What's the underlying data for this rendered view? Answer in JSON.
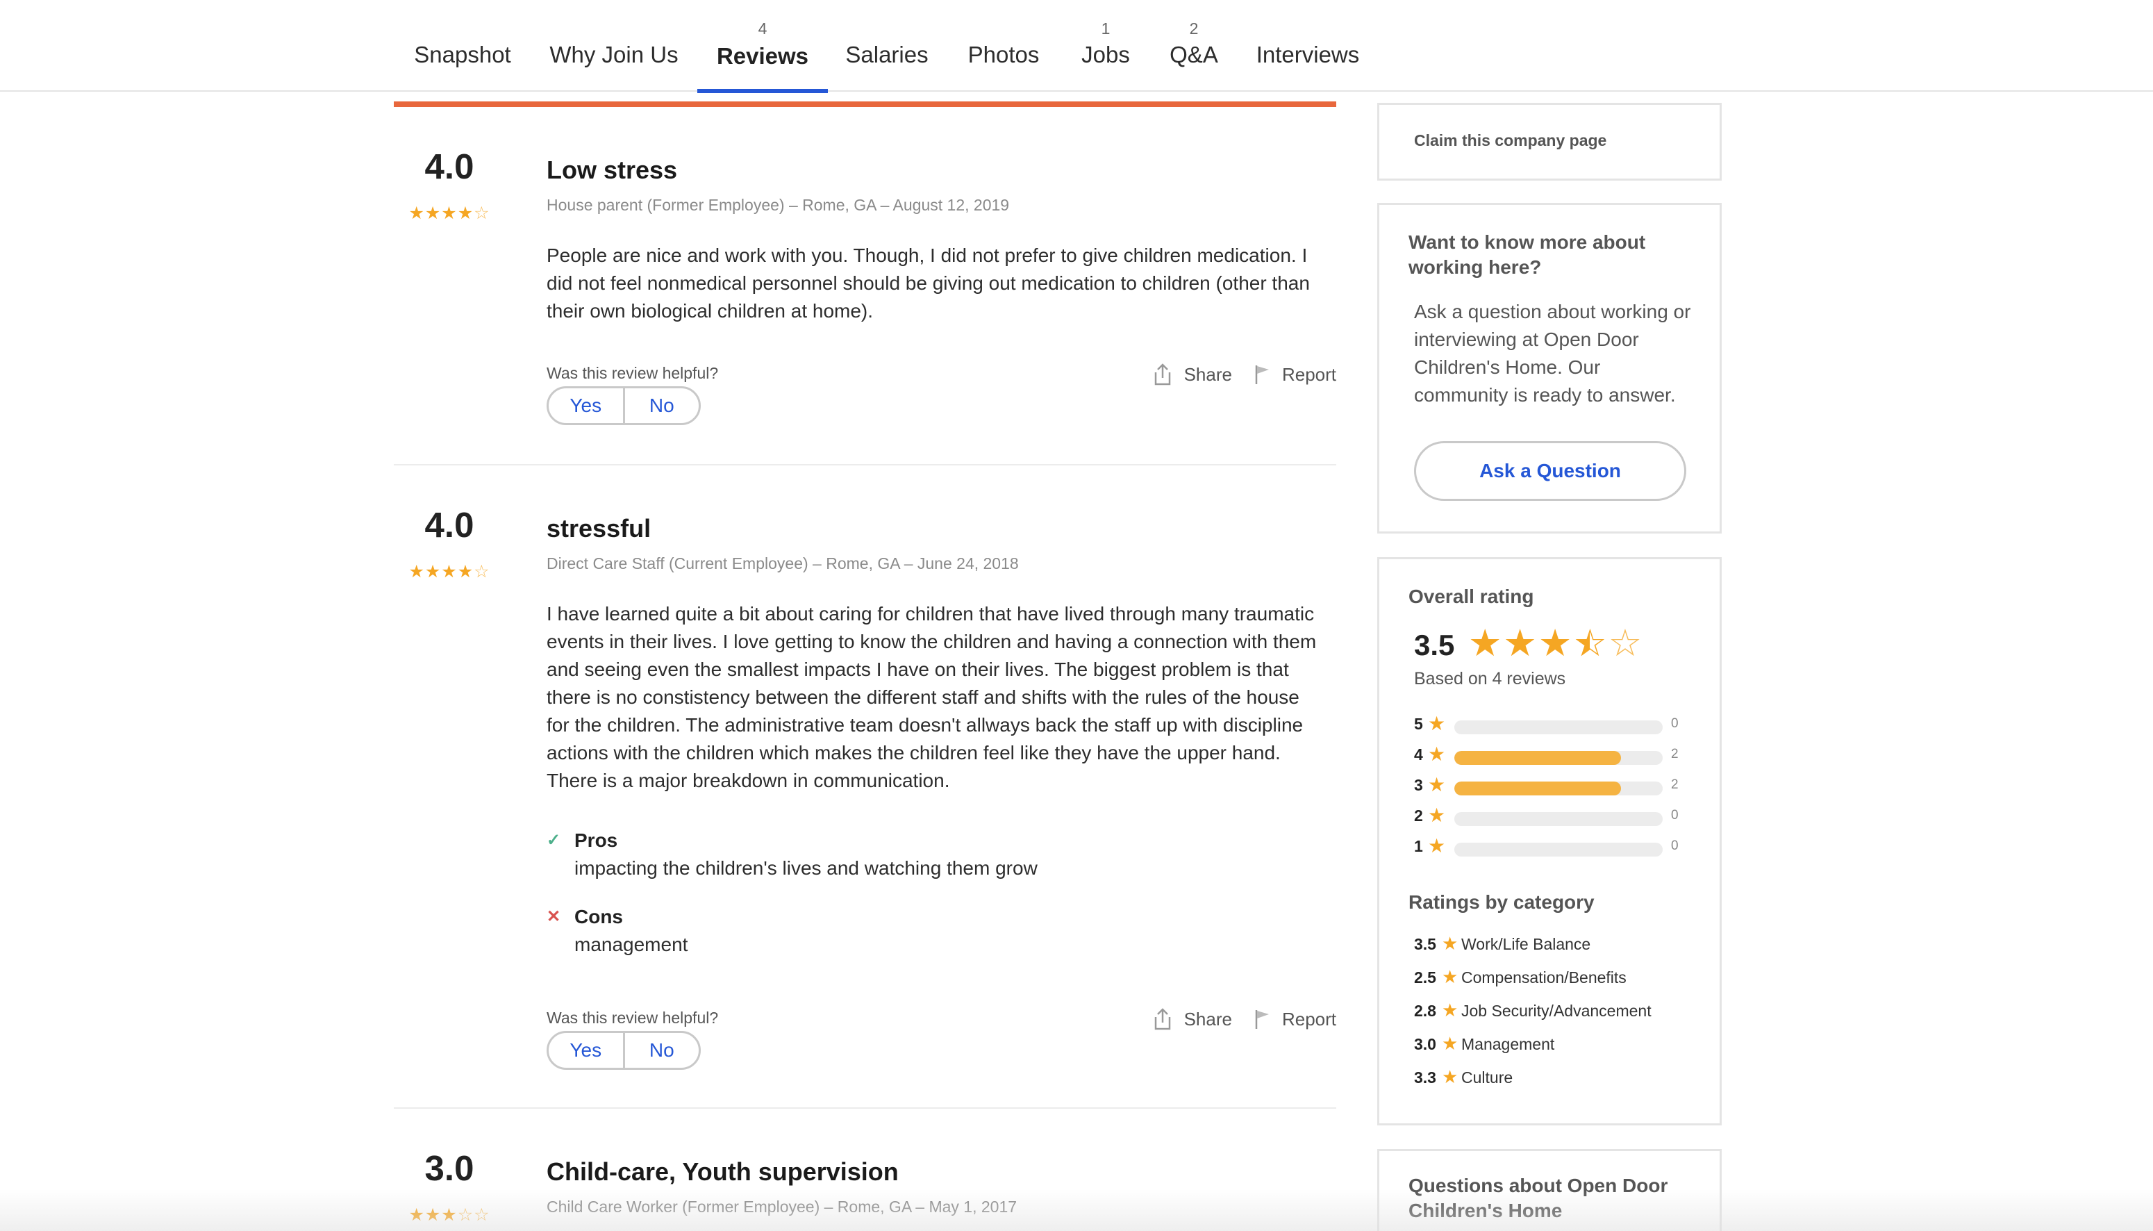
{
  "nav": {
    "tabs": [
      {
        "label": "Snapshot",
        "count": ""
      },
      {
        "label": "Why Join Us",
        "count": ""
      },
      {
        "label": "Reviews",
        "count": "4"
      },
      {
        "label": "Salaries",
        "count": ""
      },
      {
        "label": "Photos",
        "count": ""
      },
      {
        "label": "Jobs",
        "count": "1"
      },
      {
        "label": "Q&A",
        "count": "2"
      },
      {
        "label": "Interviews",
        "count": ""
      }
    ],
    "active_tab": "Reviews",
    "accent_color": "#2557d6"
  },
  "reviews": [
    {
      "rating": "4.0",
      "stars": 4,
      "title": "Low stress",
      "meta": "House parent (Former Employee) –  Rome, GA – August 12, 2019",
      "body": "People are nice and work with you. Though, I did not prefer to give children medication. I did not feel nonmedical personnel should be giving out medication to children (other than their own biological children at home).",
      "helpful_question": "Was this review helpful?",
      "yes_label": "Yes",
      "no_label": "No",
      "share_label": "Share",
      "report_label": "Report"
    },
    {
      "rating": "4.0",
      "stars": 4,
      "title": "stressful",
      "meta": "Direct Care Staff (Current Employee) –  Rome, GA – June 24, 2018",
      "body": "I have learned quite a bit about caring for children that have lived through many traumatic events in their lives. I love getting to know the children and having a connection with them and seeing even the smallest impacts I have on their lives. The biggest problem is that there is no constistency between the different staff and shifts with the rules of the house for the children. The administrative team doesn't allways back the staff up with discipline actions with the children which makes the children feel like they have the upper hand. There is a major breakdown in communication.",
      "pros_label": "Pros",
      "pros": "impacting the children's lives and watching them grow",
      "cons_label": "Cons",
      "cons": "management",
      "helpful_question": "Was this review helpful?",
      "yes_label": "Yes",
      "no_label": "No",
      "share_label": "Share",
      "report_label": "Report"
    },
    {
      "rating": "3.0",
      "stars": 3,
      "title": "Child-care, Youth supervision",
      "meta": "Child Care Worker (Former Employee) –  Rome, GA – May 1, 2017"
    }
  ],
  "sidebar": {
    "claim_link": "Claim this company page",
    "ask": {
      "heading": "Want to know more about working here?",
      "text": "Ask a question about working or interviewing at Open Door Children's Home. Our community is ready to answer.",
      "button": "Ask a Question"
    },
    "overall": {
      "heading": "Overall rating",
      "rating": "3.5",
      "stars": 3.5,
      "based_on": "Based on 4 reviews",
      "distribution": [
        {
          "stars": "5",
          "count": "0",
          "fraction": 0
        },
        {
          "stars": "4",
          "count": "2",
          "fraction": 0.8
        },
        {
          "stars": "3",
          "count": "2",
          "fraction": 0.8
        },
        {
          "stars": "2",
          "count": "0",
          "fraction": 0
        },
        {
          "stars": "1",
          "count": "0",
          "fraction": 0
        }
      ],
      "categories_heading": "Ratings by category",
      "categories": [
        {
          "value": "3.5",
          "name": "Work/Life Balance"
        },
        {
          "value": "2.5",
          "name": "Compensation/Benefits"
        },
        {
          "value": "2.8",
          "name": "Job Security/Advancement"
        },
        {
          "value": "3.0",
          "name": "Management"
        },
        {
          "value": "3.3",
          "name": "Culture"
        }
      ]
    },
    "questions_heading": "Questions about Open Door Children's Home"
  },
  "colors": {
    "accent_bar": "#e8673c",
    "star": "#f5a623",
    "bar_fill": "#f5b342",
    "link": "#2557d6"
  }
}
